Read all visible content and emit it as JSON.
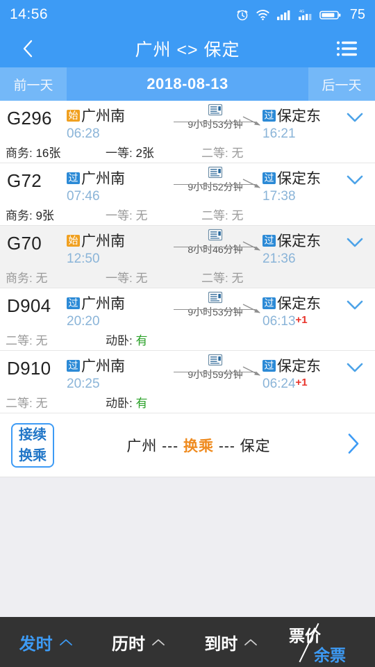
{
  "status_bar": {
    "time": "14:56",
    "battery_level": "75",
    "icons": [
      "alarm-icon",
      "wifi-icon",
      "signal-icon",
      "signal-4g-icon",
      "battery-icon"
    ]
  },
  "header": {
    "back_icon": "chevron-left-icon",
    "title": "广州 <> 保定",
    "menu_icon": "list-menu-icon"
  },
  "date_bar": {
    "prev_label": "前一天",
    "date": "2018-08-13",
    "next_label": "后一天"
  },
  "trains": [
    {
      "code": "G296",
      "dep_badge": "始",
      "dep_badge_type": "start",
      "dep_station": "广州南",
      "dep_time": "06:28",
      "duration": "9小时53分钟",
      "arr_badge": "过",
      "arr_badge_type": "pass",
      "arr_station": "保定东",
      "arr_time": "16:21",
      "next_day": "",
      "seats": [
        {
          "label": "商务:",
          "value": "16张",
          "state": "available"
        },
        {
          "label": "一等:",
          "value": "2张",
          "state": "available"
        },
        {
          "label": "二等:",
          "value": "无",
          "state": "none"
        }
      ],
      "expand_icon": "chevron-down-icon",
      "highlight": false
    },
    {
      "code": "G72",
      "dep_badge": "过",
      "dep_badge_type": "pass",
      "dep_station": "广州南",
      "dep_time": "07:46",
      "duration": "9小时52分钟",
      "arr_badge": "过",
      "arr_badge_type": "pass",
      "arr_station": "保定东",
      "arr_time": "17:38",
      "next_day": "",
      "seats": [
        {
          "label": "商务:",
          "value": "9张",
          "state": "available"
        },
        {
          "label": "一等:",
          "value": "无",
          "state": "none"
        },
        {
          "label": "二等:",
          "value": "无",
          "state": "none"
        }
      ],
      "expand_icon": "chevron-down-icon",
      "highlight": false
    },
    {
      "code": "G70",
      "dep_badge": "始",
      "dep_badge_type": "start",
      "dep_station": "广州南",
      "dep_time": "12:50",
      "duration": "8小时46分钟",
      "arr_badge": "过",
      "arr_badge_type": "pass",
      "arr_station": "保定东",
      "arr_time": "21:36",
      "next_day": "",
      "seats": [
        {
          "label": "商务:",
          "value": "无",
          "state": "none"
        },
        {
          "label": "一等:",
          "value": "无",
          "state": "none"
        },
        {
          "label": "二等:",
          "value": "无",
          "state": "none"
        }
      ],
      "expand_icon": "chevron-down-icon",
      "highlight": true
    },
    {
      "code": "D904",
      "dep_badge": "过",
      "dep_badge_type": "pass",
      "dep_station": "广州南",
      "dep_time": "20:20",
      "duration": "9小时53分钟",
      "arr_badge": "过",
      "arr_badge_type": "pass",
      "arr_station": "保定东",
      "arr_time": "06:13",
      "next_day": "+1",
      "seats": [
        {
          "label": "二等:",
          "value": "无",
          "state": "none"
        },
        {
          "label": "动卧:",
          "value": "有",
          "state": "have"
        }
      ],
      "expand_icon": "chevron-down-icon",
      "highlight": false
    },
    {
      "code": "D910",
      "dep_badge": "过",
      "dep_badge_type": "pass",
      "dep_station": "广州南",
      "dep_time": "20:25",
      "duration": "9小时59分钟",
      "arr_badge": "过",
      "arr_badge_type": "pass",
      "arr_station": "保定东",
      "arr_time": "06:24",
      "next_day": "+1",
      "seats": [
        {
          "label": "二等:",
          "value": "无",
          "state": "none"
        },
        {
          "label": "动卧:",
          "value": "有",
          "state": "have"
        }
      ],
      "expand_icon": "chevron-down-icon",
      "highlight": false
    }
  ],
  "transfer": {
    "badge_line1": "接续",
    "badge_line2": "换乘",
    "from": "广州",
    "dash_left": "---",
    "highlight": "换乘",
    "dash_right": "---",
    "to": "保定",
    "arrow_icon": "chevron-right-icon"
  },
  "bottom_bar": {
    "items": [
      {
        "label": "发时",
        "caret": "caret-up-icon",
        "active": true
      },
      {
        "label": "历时",
        "caret": "caret-up-icon",
        "active": false
      },
      {
        "label": "到时",
        "caret": "caret-up-icon",
        "active": false
      }
    ],
    "price_label": "票价",
    "remaining_label": "余票"
  },
  "colors": {
    "brand_blue": "#3d9bf5",
    "badge_start_orange": "#f0a020",
    "badge_pass_blue": "#2c8ad6",
    "available_green": "#2aa128",
    "next_day_red": "#e8322a",
    "transfer_orange": "#ef8b1f",
    "bottom_bar_dark": "#333333"
  }
}
